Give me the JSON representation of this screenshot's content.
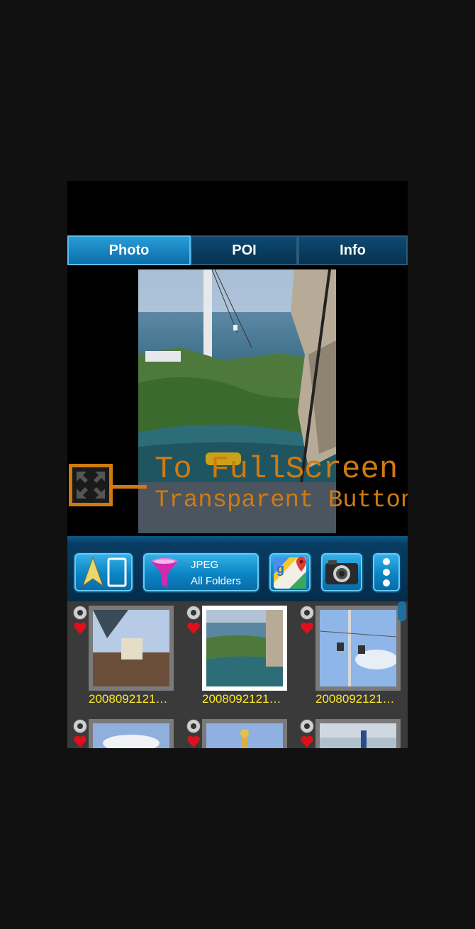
{
  "tabs": [
    {
      "label": "Photo",
      "active": true
    },
    {
      "label": "POI",
      "active": false
    },
    {
      "label": "Info",
      "active": false
    }
  ],
  "overlay": {
    "line1": "To FullScreen",
    "line2": "Transparent Button",
    "color": "#d07a10"
  },
  "toolbar": {
    "filter_type": "JPEG",
    "filter_folder": "All Folders",
    "icons": [
      "navigation-split-icon",
      "filter-funnel-icon",
      "google-maps-icon",
      "camera-icon",
      "more-vert-icon"
    ]
  },
  "grid": {
    "items": [
      {
        "name": "2008092121…",
        "selected": false
      },
      {
        "name": "2008092121…",
        "selected": true
      },
      {
        "name": "2008092121…",
        "selected": false
      },
      {
        "name": "",
        "selected": false
      },
      {
        "name": "",
        "selected": false
      },
      {
        "name": "",
        "selected": false
      }
    ]
  },
  "colors": {
    "tab_active": "#0a6ea8",
    "tab_inactive": "#063250",
    "filename": "#ffe82a",
    "favorite": "#e0101a"
  }
}
